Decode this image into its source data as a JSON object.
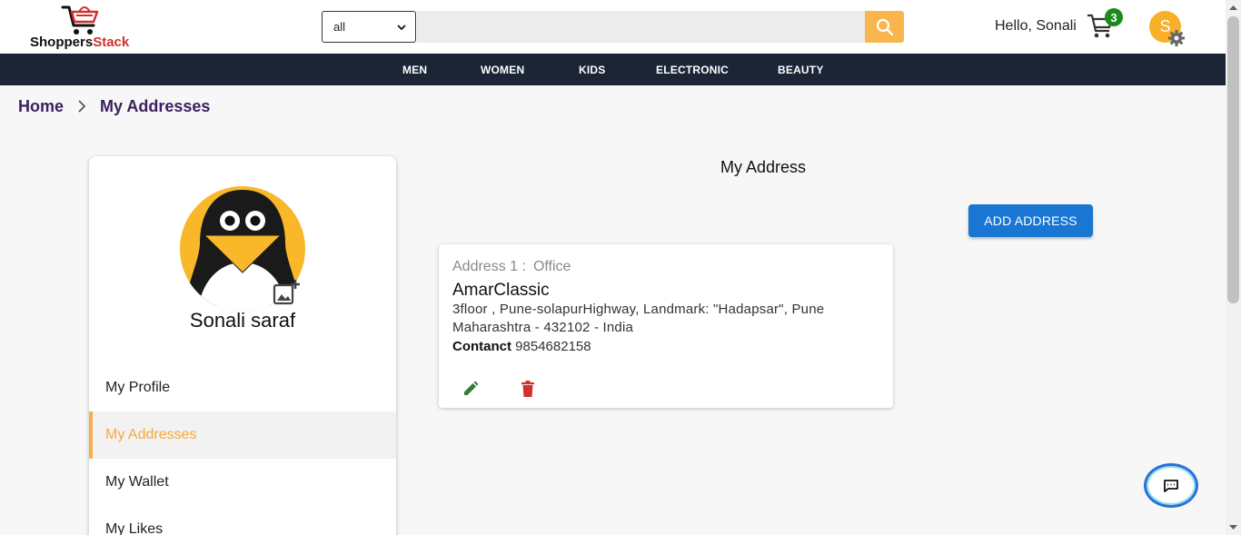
{
  "header": {
    "brand_part1": "Shoppers",
    "brand_part2": "Stack",
    "search_category": "all",
    "search_placeholder": "",
    "greeting": "Hello, Sonali",
    "cart_count": "3",
    "avatar_initial": "S"
  },
  "nav": {
    "items": [
      "MEN",
      "WOMEN",
      "KIDS",
      "ELECTRONIC",
      "BEAUTY"
    ]
  },
  "breadcrumb": {
    "home": "Home",
    "current": "My Addresses"
  },
  "sidebar": {
    "user_name": "Sonali saraf",
    "items": [
      {
        "label": "My Profile",
        "active": false
      },
      {
        "label": "My Addresses",
        "active": true
      },
      {
        "label": "My Wallet",
        "active": false
      },
      {
        "label": "My Likes",
        "active": false
      }
    ]
  },
  "main": {
    "title": "My Address",
    "add_button": "ADD ADDRESS",
    "address": {
      "label": "Address 1 :",
      "type": "Office",
      "name": "AmarClassic",
      "line1": "3floor , Pune-solapurHighway, Landmark: \"Hadapsar\", Pune",
      "line2": "Maharashtra - 432102 - India",
      "contact_label": "Contanct",
      "contact_value": "9854682158"
    }
  },
  "icons": {
    "cart": "cart-icon",
    "search": "search-icon",
    "settings": "gear-icon",
    "edit": "pencil-icon",
    "delete": "trash-icon",
    "chat": "chat-icon",
    "add_photo": "add-photo-icon"
  },
  "colors": {
    "nav_bg": "#1b2536",
    "accent": "#f8b64c",
    "primary_button": "#1976d2",
    "badge": "#1c8a1c",
    "delete": "#d32f2f",
    "edit": "#2e7d32"
  }
}
